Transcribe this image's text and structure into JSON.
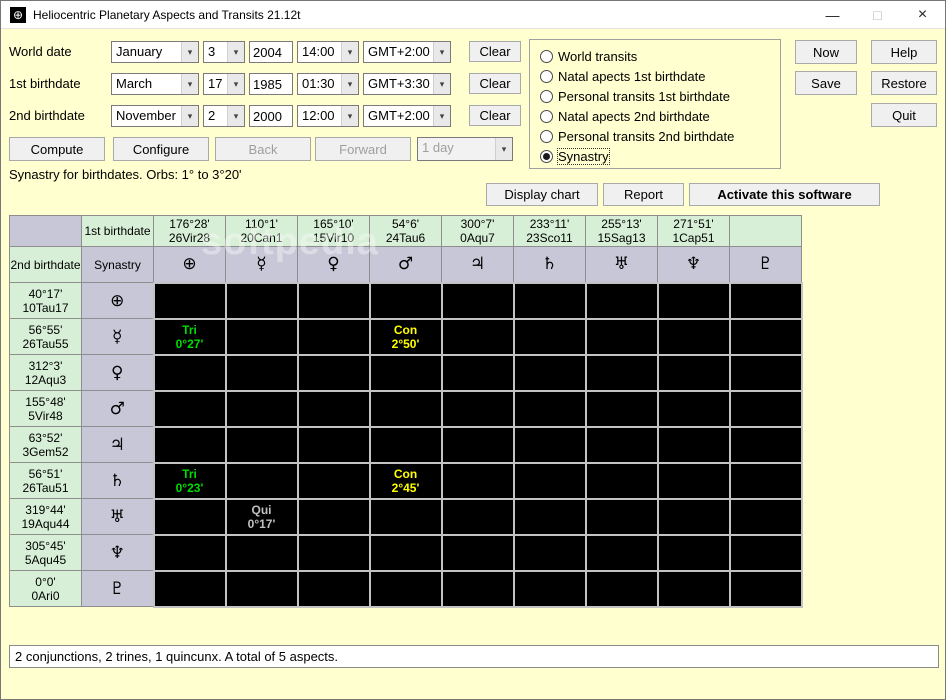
{
  "window": {
    "title": "Heliocentric Planetary Aspects and Transits 21.12t",
    "icon_glyph": "⊕",
    "minimize_glyph": "—",
    "maximize_glyph": "□",
    "close_glyph": "×"
  },
  "labels": {
    "clear": "Clear"
  },
  "date_rows": [
    {
      "label": "World date",
      "month": "January",
      "day": "3",
      "year": "2004",
      "time": "14:00",
      "tz": "GMT+2:00"
    },
    {
      "label": "1st birthdate",
      "month": "March",
      "day": "17",
      "year": "1985",
      "time": "01:30",
      "tz": "GMT+3:30"
    },
    {
      "label": "2nd birthdate",
      "month": "November",
      "day": "2",
      "year": "2000",
      "time": "12:00",
      "tz": "GMT+2:00"
    }
  ],
  "radios": {
    "selected_index": 5,
    "options": [
      {
        "label": "World transits",
        "selected": false
      },
      {
        "label": "Natal apects 1st birthdate",
        "selected": false
      },
      {
        "label": "Personal transits 1st birthdate",
        "selected": false
      },
      {
        "label": "Natal apects 2nd birthdate",
        "selected": false
      },
      {
        "label": "Personal transits 2nd birthdate",
        "selected": false
      },
      {
        "label": "Synastry",
        "selected": true
      }
    ]
  },
  "side_buttons": {
    "now": "Now",
    "help": "Help",
    "save": "Save",
    "restore": "Restore",
    "quit": "Quit"
  },
  "actions": {
    "compute": "Compute",
    "configure": "Configure",
    "back": "Back",
    "forward": "Forward",
    "step_value": "1 day"
  },
  "status_line": "Synastry for birthdates.  Orbs: 1° to 3°20'",
  "chart_buttons": {
    "display_chart": "Display chart",
    "report": "Report",
    "activate": "Activate this software"
  },
  "watermark": "softpedia",
  "colors": {
    "window_bg": "#ffffd0",
    "header_green": "#d7efd7",
    "header_gray": "#c7c7d7",
    "cell_black": "#000000",
    "trine": "#00dd00",
    "conjunction": "#ffff00",
    "quincunx": "#c0c0c0"
  },
  "grid": {
    "first_birthdate_label": "1st birthdate",
    "second_birthdate_label": "2nd birthdate",
    "synastry_label": "Synastry",
    "columns": [
      {
        "name": "earth",
        "symbol": "⊕",
        "position": "176°28'",
        "zodiac": "26Vir28"
      },
      {
        "name": "mercury",
        "symbol": "☿",
        "position": "110°1'",
        "zodiac": "20Can1"
      },
      {
        "name": "venus",
        "symbol": "♀",
        "position": "165°10'",
        "zodiac": "15Vir10"
      },
      {
        "name": "mars",
        "symbol": "♂",
        "position": "54°6'",
        "zodiac": "24Tau6"
      },
      {
        "name": "jupiter",
        "symbol": "♃",
        "position": "300°7'",
        "zodiac": "0Aqu7"
      },
      {
        "name": "saturn",
        "symbol": "♄",
        "position": "233°11'",
        "zodiac": "23Sco11"
      },
      {
        "name": "uranus",
        "symbol": "♅",
        "position": "255°13'",
        "zodiac": "15Sag13"
      },
      {
        "name": "neptune",
        "symbol": "♆",
        "position": "271°51'",
        "zodiac": "1Cap51"
      },
      {
        "name": "pluto",
        "symbol": "♇",
        "position": "",
        "zodiac": ""
      }
    ],
    "rows": [
      {
        "name": "earth",
        "symbol": "⊕",
        "position": "40°17'",
        "zodiac": "10Tau17",
        "aspects": {}
      },
      {
        "name": "mercury",
        "symbol": "☿",
        "position": "56°55'",
        "zodiac": "26Tau55",
        "aspects": {
          "0": {
            "label": "Tri",
            "orb": "0°27'",
            "kind": "trine"
          },
          "3": {
            "label": "Con",
            "orb": "2°50'",
            "kind": "conjunction"
          }
        }
      },
      {
        "name": "venus",
        "symbol": "♀",
        "position": "312°3'",
        "zodiac": "12Aqu3",
        "aspects": {}
      },
      {
        "name": "mars",
        "symbol": "♂",
        "position": "155°48'",
        "zodiac": "5Vir48",
        "aspects": {}
      },
      {
        "name": "jupiter",
        "symbol": "♃",
        "position": "63°52'",
        "zodiac": "3Gem52",
        "aspects": {}
      },
      {
        "name": "saturn",
        "symbol": "♄",
        "position": "56°51'",
        "zodiac": "26Tau51",
        "aspects": {
          "0": {
            "label": "Tri",
            "orb": "0°23'",
            "kind": "trine"
          },
          "3": {
            "label": "Con",
            "orb": "2°45'",
            "kind": "conjunction"
          }
        }
      },
      {
        "name": "uranus",
        "symbol": "♅",
        "position": "319°44'",
        "zodiac": "19Aqu44",
        "aspects": {
          "1": {
            "label": "Qui",
            "orb": "0°17'",
            "kind": "quincunx"
          }
        }
      },
      {
        "name": "neptune",
        "symbol": "♆",
        "position": "305°45'",
        "zodiac": "5Aqu45",
        "aspects": {}
      },
      {
        "name": "pluto",
        "symbol": "♇",
        "position": "0°0'",
        "zodiac": "0Ari0",
        "aspects": {}
      }
    ]
  },
  "summary": "2 conjunctions, 2 trines, 1 quincunx. A total of 5 aspects."
}
